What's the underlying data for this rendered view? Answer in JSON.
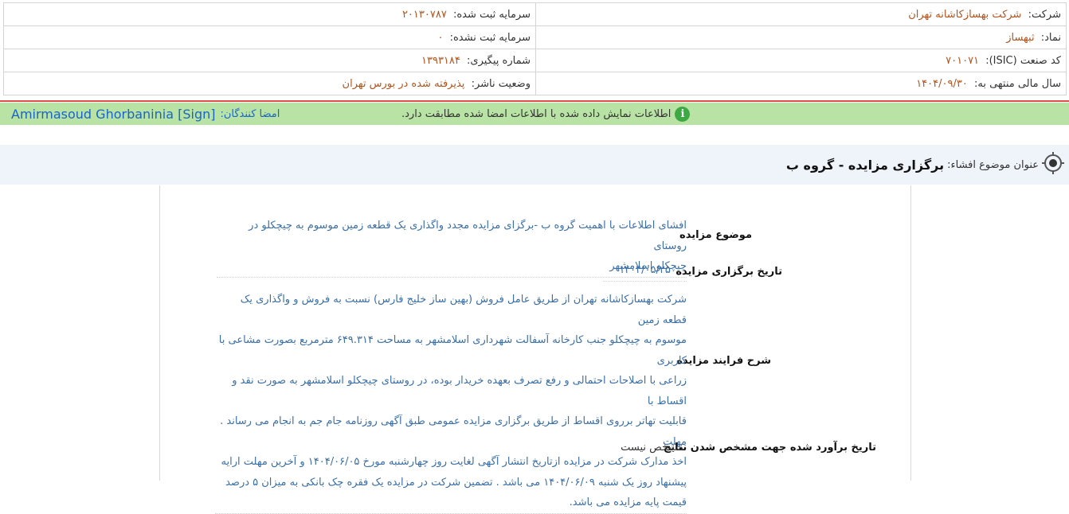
{
  "company_info": {
    "company_label": "شرکت:",
    "company_value": "شرکت بهسازکاشانه تهران",
    "registered_capital_label": "سرمایه ثبت شده:",
    "registered_capital_value": "۲۰۱۳۰۷۸۷",
    "symbol_label": "نماد:",
    "symbol_value": "ثبهساز",
    "unregistered_capital_label": "سرمایه ثبت نشده:",
    "unregistered_capital_value": "۰",
    "isic_label": "کد صنعت (ISIC):",
    "isic_value": "۷۰۱۰۷۱",
    "tracking_label": "شماره پیگیری:",
    "tracking_value": "۱۳۹۳۱۸۴",
    "fiscal_year_label": "سال مالی منتهی به:",
    "fiscal_year_value": "۱۴۰۴/۰۹/۳۰",
    "publisher_status_label": "وضعیت ناشر:",
    "publisher_status_value": "پذیرفته شده در بورس تهران"
  },
  "verification": {
    "message": "اطلاعات نمایش داده شده با اطلاعات امضا شده مطابقت دارد.",
    "signers_label": "امضا کنندگان:",
    "signer_name": "Amirmasoud Ghorbaninia [Sign]"
  },
  "disclosure": {
    "subject_label": "عنوان موضوع افشاء:",
    "subject_title": "برگزاری مزایده - گروه ب"
  },
  "details": {
    "auction_subject_label": "موضوع مزایده",
    "auction_subject_lines": [
      "افشای اطلاعات با اهمیت گروه ب -برگزای مزایده مجدد واگذاری یک قطعه زمین موسوم به چیچکلو در روستای",
      "چیچکلو اسلامشهر"
    ],
    "auction_date_label": "تاریخ برگزاری مزایده",
    "auction_date_value": "۱۴۰۴/۰۵/۲۵",
    "process_label": "شرح فرایند مزایده",
    "process_lines": [
      "شرکت بهسازکاشانه تهران از طریق عامل فروش (بهین ساز خلیج فارس) نسبت به فروش و واگذاری یک قطعه زمین",
      "موسوم به چیچکلو جنب کارخانه آسفالت شهرداری اسلامشهر به مساحت ۶۴۹.۳۱۴ مترمربع بصورت مشاعی با کاربری",
      "زراعی با اصلاحات احتمالی و رفع تصرف بعهده خریدار بوده، در روستای چیچکلو اسلامشهر به صورت نقد و اقساط با",
      "قابلیت تهاتر برروی اقساط از طریق برگزاری مزایده عمومی طبق آگهی روزنامه جام جم به انجام می رساند . مهلت",
      "اخذ مدارک شرکت در مزایده ازتاریخ انتشار آگهی لغایت روز چهارشنبه مورخ ۱۴۰۴/۰۶/۰۵ و آخرین مهلت ارایه",
      "پیشنهاد روز یک شنبه ۱۴۰۴/۰۶/۰۹ می باشد . تضمین شرکت در مزایده یک فقره چک بانکی به میزان ۵ درصد",
      "قیمت پایه مزایده می باشد."
    ],
    "estimate_label": "تاریخ برآورد شده جهت مشخص شدن نتایج",
    "estimate_value": "مشخص نیست"
  }
}
